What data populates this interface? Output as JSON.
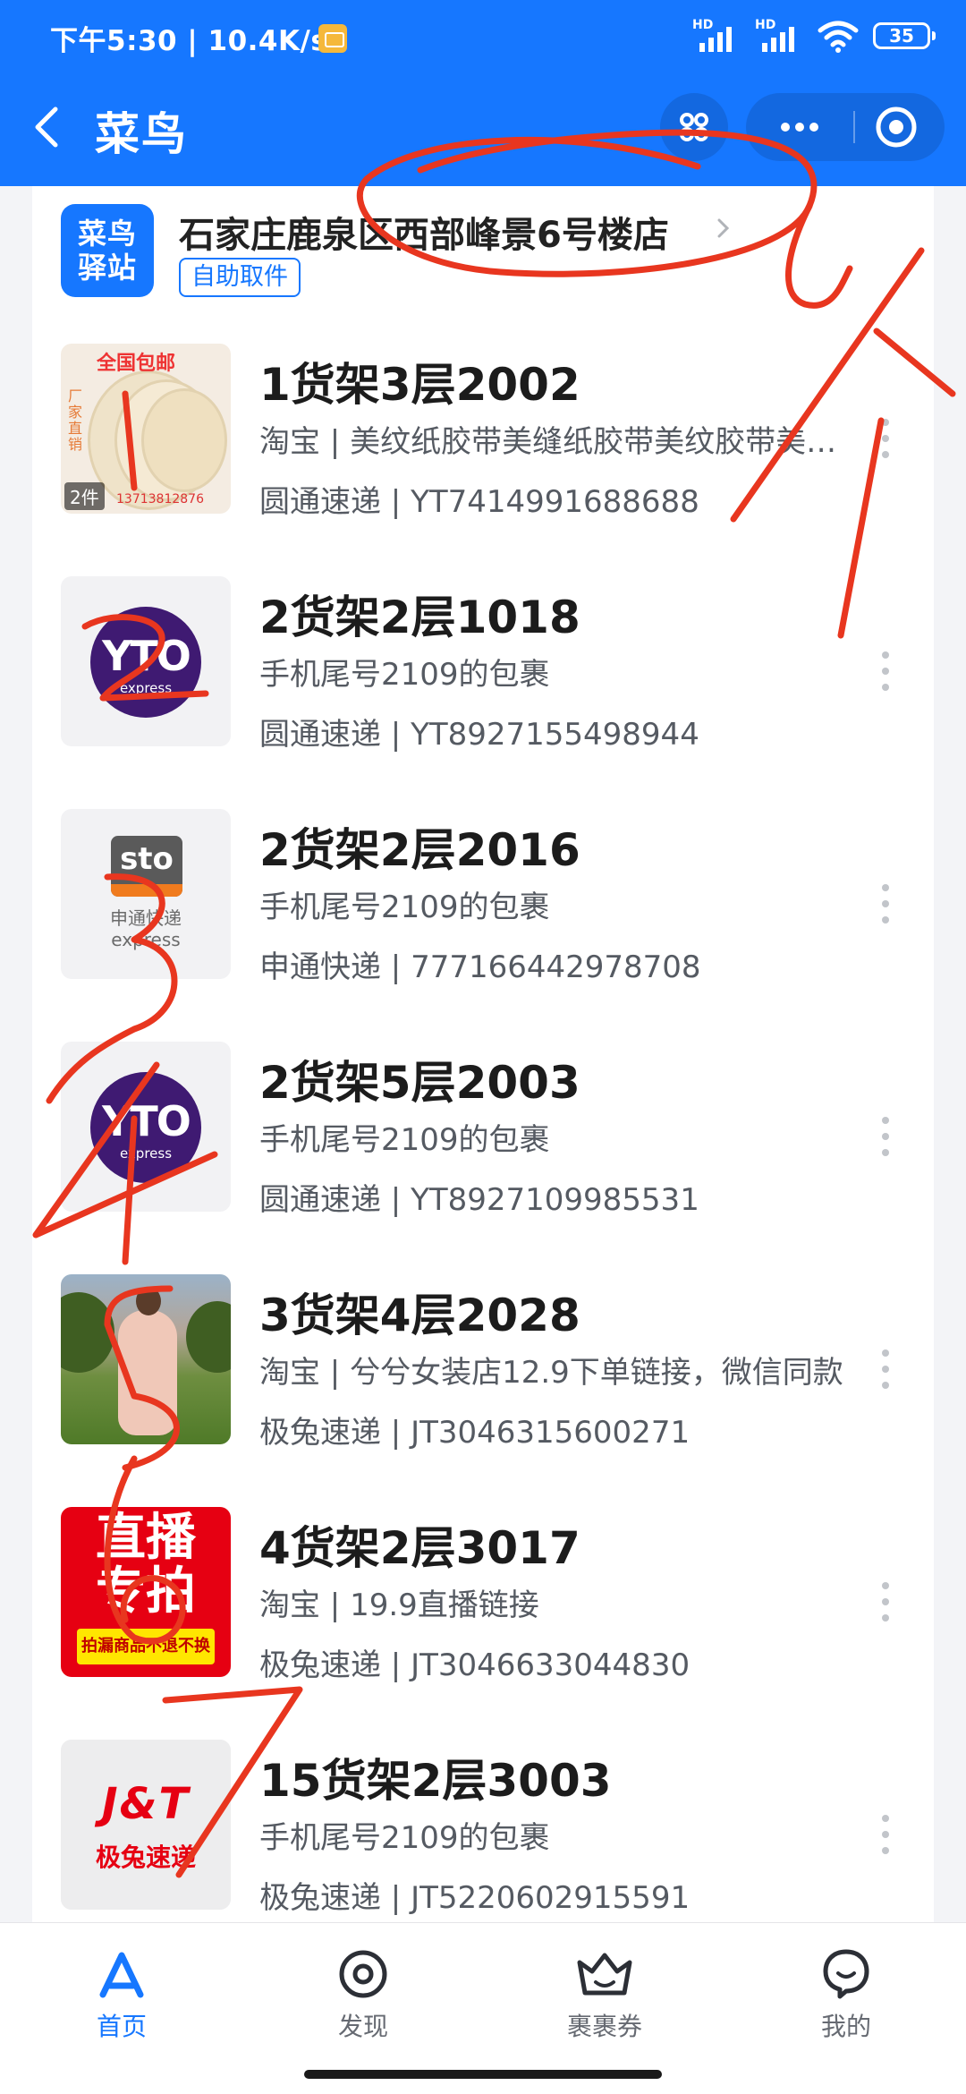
{
  "status_bar": {
    "time_speed": "下午5:30 | 10.4K/s",
    "hd_1": "HD",
    "hd_2": "HD",
    "battery": "35"
  },
  "title_bar": {
    "title": "菜鸟"
  },
  "station": {
    "logo_text": "菜鸟驿站",
    "logo_line1": "菜鸟",
    "logo_line2": "驿站",
    "name": "石家庄鹿泉区西部峰景6号楼店",
    "pickup_tag": "自助取件"
  },
  "packages": [
    {
      "code": "1货架3层2002",
      "desc": "淘宝 | 美纹纸胶带美缝纸胶带美纹胶带美纹纸",
      "tracking": "圆通速递 | YT7414991688688",
      "thumb": "tape-product",
      "thumb_text": {
        "top": "全国包邮",
        "side": "厂家直销",
        "count": "2件",
        "phone": "13713812876"
      }
    },
    {
      "code": "2货架2层1018",
      "desc": "手机尾号2109的包裹",
      "tracking": "圆通速递 | YT8927155498944",
      "thumb": "yto-logo",
      "thumb_text": {
        "main": "YTO",
        "sub": "express"
      }
    },
    {
      "code": "2货架2层2016",
      "desc": "手机尾号2109的包裹",
      "tracking": "申通快递 | 777166442978708",
      "thumb": "sto-logo",
      "thumb_text": {
        "main": "sto",
        "sub1": "申通快递",
        "sub2": "express"
      }
    },
    {
      "code": "2货架5层2003",
      "desc": "手机尾号2109的包裹",
      "tracking": "圆通速递 | YT8927109985531",
      "thumb": "yto-logo",
      "thumb_text": {
        "main": "YTO",
        "sub": "express"
      }
    },
    {
      "code": "3货架4层2028",
      "desc": "淘宝 | 兮兮女装店12.9下单链接，微信同款",
      "tracking": "极兔速递 | JT3046315600271",
      "thumb": "dress-photo"
    },
    {
      "code": "4货架2层3017",
      "desc": "淘宝 | 19.9直播链接",
      "tracking": "极兔速递 | JT3046633044830",
      "thumb": "live-sale-banner",
      "thumb_text": {
        "line1": "直播",
        "line2": "专拍",
        "line3": "拍漏商品不退不换"
      }
    },
    {
      "code": "15货架2层3003",
      "desc": "手机尾号2109的包裹",
      "tracking": "极兔速递 | JT5220602915591",
      "thumb": "jt-logo",
      "thumb_text": {
        "main": "J&T",
        "sub": "极兔速递"
      }
    }
  ],
  "tab_bar": {
    "tabs": [
      {
        "label": "首页",
        "icon": "home-a-icon",
        "active": true
      },
      {
        "label": "发现",
        "icon": "discover-icon",
        "active": false
      },
      {
        "label": "裹裹券",
        "icon": "coupon-crown-icon",
        "active": false
      },
      {
        "label": "我的",
        "icon": "profile-icon",
        "active": false
      }
    ]
  },
  "colors": {
    "brand_blue": "#1677ff",
    "annotation_red": "#e8361f",
    "text_dark": "#1c1c1c",
    "text_secondary": "#555a62"
  },
  "annotations": {
    "handwritten_numbers": [
      "1",
      "2",
      "3",
      "4",
      "5",
      "6",
      "7"
    ]
  }
}
